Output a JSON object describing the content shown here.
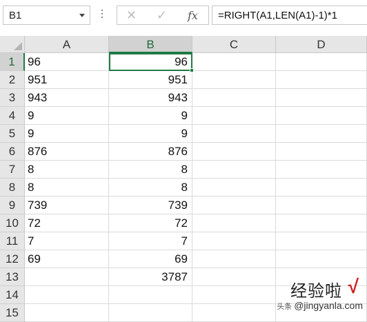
{
  "formula_bar": {
    "name_box": "B1",
    "cancel_icon": "✕",
    "enter_icon": "✓",
    "fx_label": "fx",
    "formula": "=RIGHT(A1,LEN(A1)-1)*1"
  },
  "columns": [
    "A",
    "B",
    "C",
    "D"
  ],
  "selected": {
    "column": "B",
    "row": 1
  },
  "rows": [
    {
      "n": "1",
      "a": "96",
      "b": "96"
    },
    {
      "n": "2",
      "a": "951",
      "b": "951"
    },
    {
      "n": "3",
      "a": "943",
      "b": "943"
    },
    {
      "n": "4",
      "a": "9",
      "b": "9"
    },
    {
      "n": "5",
      "a": "9",
      "b": "9"
    },
    {
      "n": "6",
      "a": "876",
      "b": "876"
    },
    {
      "n": "7",
      "a": "8",
      "b": "8"
    },
    {
      "n": "8",
      "a": "8",
      "b": "8"
    },
    {
      "n": "9",
      "a": "739",
      "b": "739"
    },
    {
      "n": "10",
      "a": "72",
      "b": "72"
    },
    {
      "n": "11",
      "a": "7",
      "b": "7"
    },
    {
      "n": "12",
      "a": "69",
      "b": "69"
    },
    {
      "n": "13",
      "a": "",
      "b": "3787"
    },
    {
      "n": "14",
      "a": "",
      "b": ""
    },
    {
      "n": "15",
      "a": "",
      "b": ""
    }
  ],
  "watermark": {
    "big": "经验啦",
    "check": "√",
    "prefix": "头条",
    "small": "@jingyanla.com"
  },
  "colors": {
    "accent": "#1f7a45",
    "watermark_check": "#d02020"
  }
}
